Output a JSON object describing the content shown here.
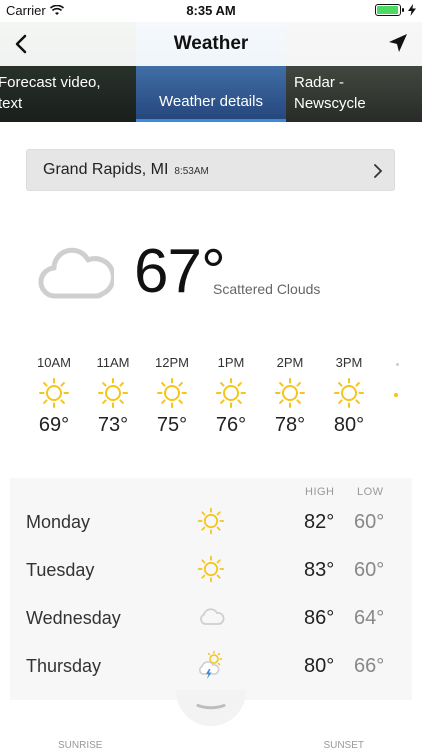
{
  "status": {
    "carrier": "Carrier",
    "time": "8:35 AM",
    "battery_level": 0.95
  },
  "nav": {
    "title": "Weather",
    "back_icon": "chevron-left-icon",
    "location_icon": "location-arrow-icon"
  },
  "carousel": [
    {
      "label_line1": "Forecast video,",
      "label_line2": "text"
    },
    {
      "label_line1": "Weather details",
      "selected": true
    },
    {
      "label_line1": "Radar -",
      "label_line2": "Newscycle"
    }
  ],
  "location": {
    "name": "Grand Rapids, MI",
    "time": "8:53AM"
  },
  "current": {
    "temp": "67°",
    "condition": "Scattered Clouds",
    "icon": "cloud-icon"
  },
  "hourly": [
    {
      "time": "10AM",
      "temp": "69°",
      "icon": "sun-icon"
    },
    {
      "time": "11AM",
      "temp": "73°",
      "icon": "sun-icon"
    },
    {
      "time": "12PM",
      "temp": "75°",
      "icon": "sun-icon"
    },
    {
      "time": "1PM",
      "temp": "76°",
      "icon": "sun-icon"
    },
    {
      "time": "2PM",
      "temp": "78°",
      "icon": "sun-icon"
    },
    {
      "time": "3PM",
      "temp": "80°",
      "icon": "sun-icon"
    }
  ],
  "daily": {
    "high_label": "HIGH",
    "low_label": "LOW",
    "days": [
      {
        "name": "Monday",
        "high": "82°",
        "low": "60°",
        "icon": "sun-icon"
      },
      {
        "name": "Tuesday",
        "high": "83°",
        "low": "60°",
        "icon": "sun-icon"
      },
      {
        "name": "Wednesday",
        "high": "86°",
        "low": "64°",
        "icon": "cloud-icon"
      },
      {
        "name": "Thursday",
        "high": "80°",
        "low": "66°",
        "icon": "thunderstorm-sun-icon"
      }
    ]
  },
  "sun": {
    "sunrise_label": "SUNRISE",
    "sunset_label": "SUNSET"
  },
  "colors": {
    "sun": "#f5c518",
    "accent": "#3b8bd9",
    "cloud": "#cfcfcf"
  }
}
